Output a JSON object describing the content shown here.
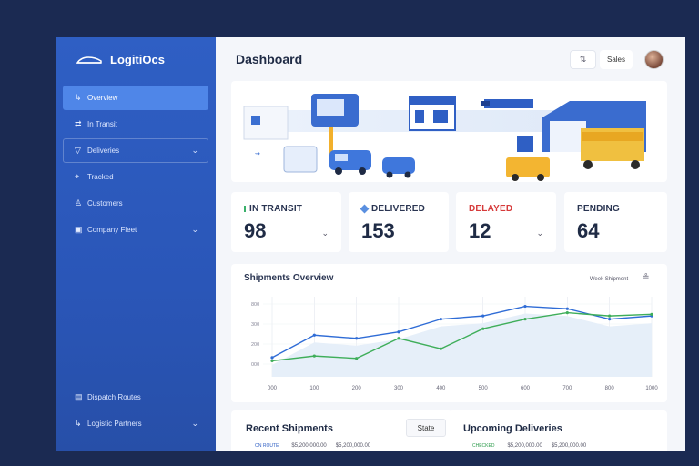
{
  "app": {
    "brand": "LogitiOcs"
  },
  "sidebar": {
    "items": [
      {
        "label": "Overview",
        "icon": "truck-icon",
        "active": true,
        "chevron": ""
      },
      {
        "label": "In Transit",
        "icon": "arrows-icon",
        "chevron": ""
      },
      {
        "label": "Deliveries",
        "icon": "box-icon",
        "chevron": "⌄"
      },
      {
        "label": "Tracked",
        "icon": "pin-icon",
        "chevron": ""
      },
      {
        "label": "Customers",
        "icon": "user-icon",
        "chevron": ""
      },
      {
        "label": "Company Fleet",
        "icon": "building-icon",
        "chevron": "⌄"
      }
    ],
    "bottom": [
      {
        "label": "Dispatch Routes",
        "icon": "map-icon",
        "chevron": ""
      },
      {
        "label": "Logistic Partners",
        "icon": "partners-icon",
        "chevron": "⌄"
      }
    ]
  },
  "header": {
    "title": "Dashboard",
    "icon_btn": "⇅",
    "text_btn": "Sales"
  },
  "stats": [
    {
      "label": "IN TRANSIT",
      "value": "98",
      "color": "#2a3552",
      "accent": "#3ab06a"
    },
    {
      "label": "DELIVERED",
      "value": "153",
      "color": "#2a3552",
      "accent": "#5a8fe0"
    },
    {
      "label": "DELAYED",
      "value": "12",
      "color": "#d63a3a",
      "accent": ""
    },
    {
      "label": "PENDING",
      "value": "64",
      "color": "#2a3552",
      "accent": ""
    }
  ],
  "chart": {
    "title": "Shipments Overview",
    "filter": "Week Shipment",
    "option_icon": "≗"
  },
  "chart_data": {
    "type": "line",
    "x": [
      "000",
      "100",
      "200",
      "300",
      "400",
      "500",
      "600",
      "700",
      "800",
      "1000"
    ],
    "yticks": [
      "000",
      "200",
      "300",
      "800"
    ],
    "series": [
      {
        "values": [
          240,
          520,
          480,
          560,
          720,
          760,
          880,
          850,
          720,
          760
        ]
      },
      {
        "values": [
          200,
          260,
          230,
          480,
          350,
          600,
          720,
          800,
          760,
          780
        ]
      }
    ],
    "ylim": [
      0,
      1000
    ],
    "colors": [
      "#2f6cd6",
      "#3fae5a"
    ]
  },
  "recent": {
    "title": "Recent Shipments",
    "button": "State",
    "row": {
      "tag": "ON ROUTE",
      "c1": "$5,200,000.00",
      "c2": "$5,200,000.00"
    }
  },
  "upcoming": {
    "title": "Upcoming Deliveries",
    "row": {
      "tag": "CHECKED",
      "c1": "$5,200,000.00",
      "c2": "$5,200,000.00"
    }
  },
  "colors": {
    "sidebar": "#2a56b8",
    "active": "#4f86e8",
    "page_bg": "#1b2a52"
  }
}
